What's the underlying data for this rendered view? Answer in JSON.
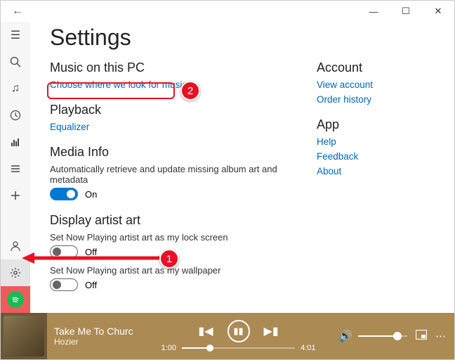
{
  "titlebar": {
    "back": "←",
    "min": "—",
    "max": "☐",
    "close": "✕"
  },
  "page": {
    "title": "Settings"
  },
  "sections": {
    "music": {
      "heading": "Music on this PC",
      "link": "Choose where we look for music"
    },
    "playback": {
      "heading": "Playback",
      "link": "Equalizer"
    },
    "mediainfo": {
      "heading": "Media Info",
      "desc": "Automatically retrieve and update missing album art and metadata",
      "toggle_label": "On"
    },
    "artistart": {
      "heading": "Display artist art",
      "opt1": "Set Now Playing artist art as my lock screen",
      "opt1_label": "Off",
      "opt2": "Set Now Playing artist art as my wallpaper",
      "opt2_label": "Off"
    }
  },
  "right": {
    "account": {
      "heading": "Account",
      "view": "View account",
      "order": "Order history"
    },
    "app": {
      "heading": "App",
      "help": "Help",
      "feedback": "Feedback",
      "about": "About"
    }
  },
  "callouts": {
    "one": "1",
    "two": "2"
  },
  "player": {
    "track": "Take Me To Churc",
    "artist": "Hozier",
    "time_cur": "1:00",
    "time_tot": "4:01"
  }
}
